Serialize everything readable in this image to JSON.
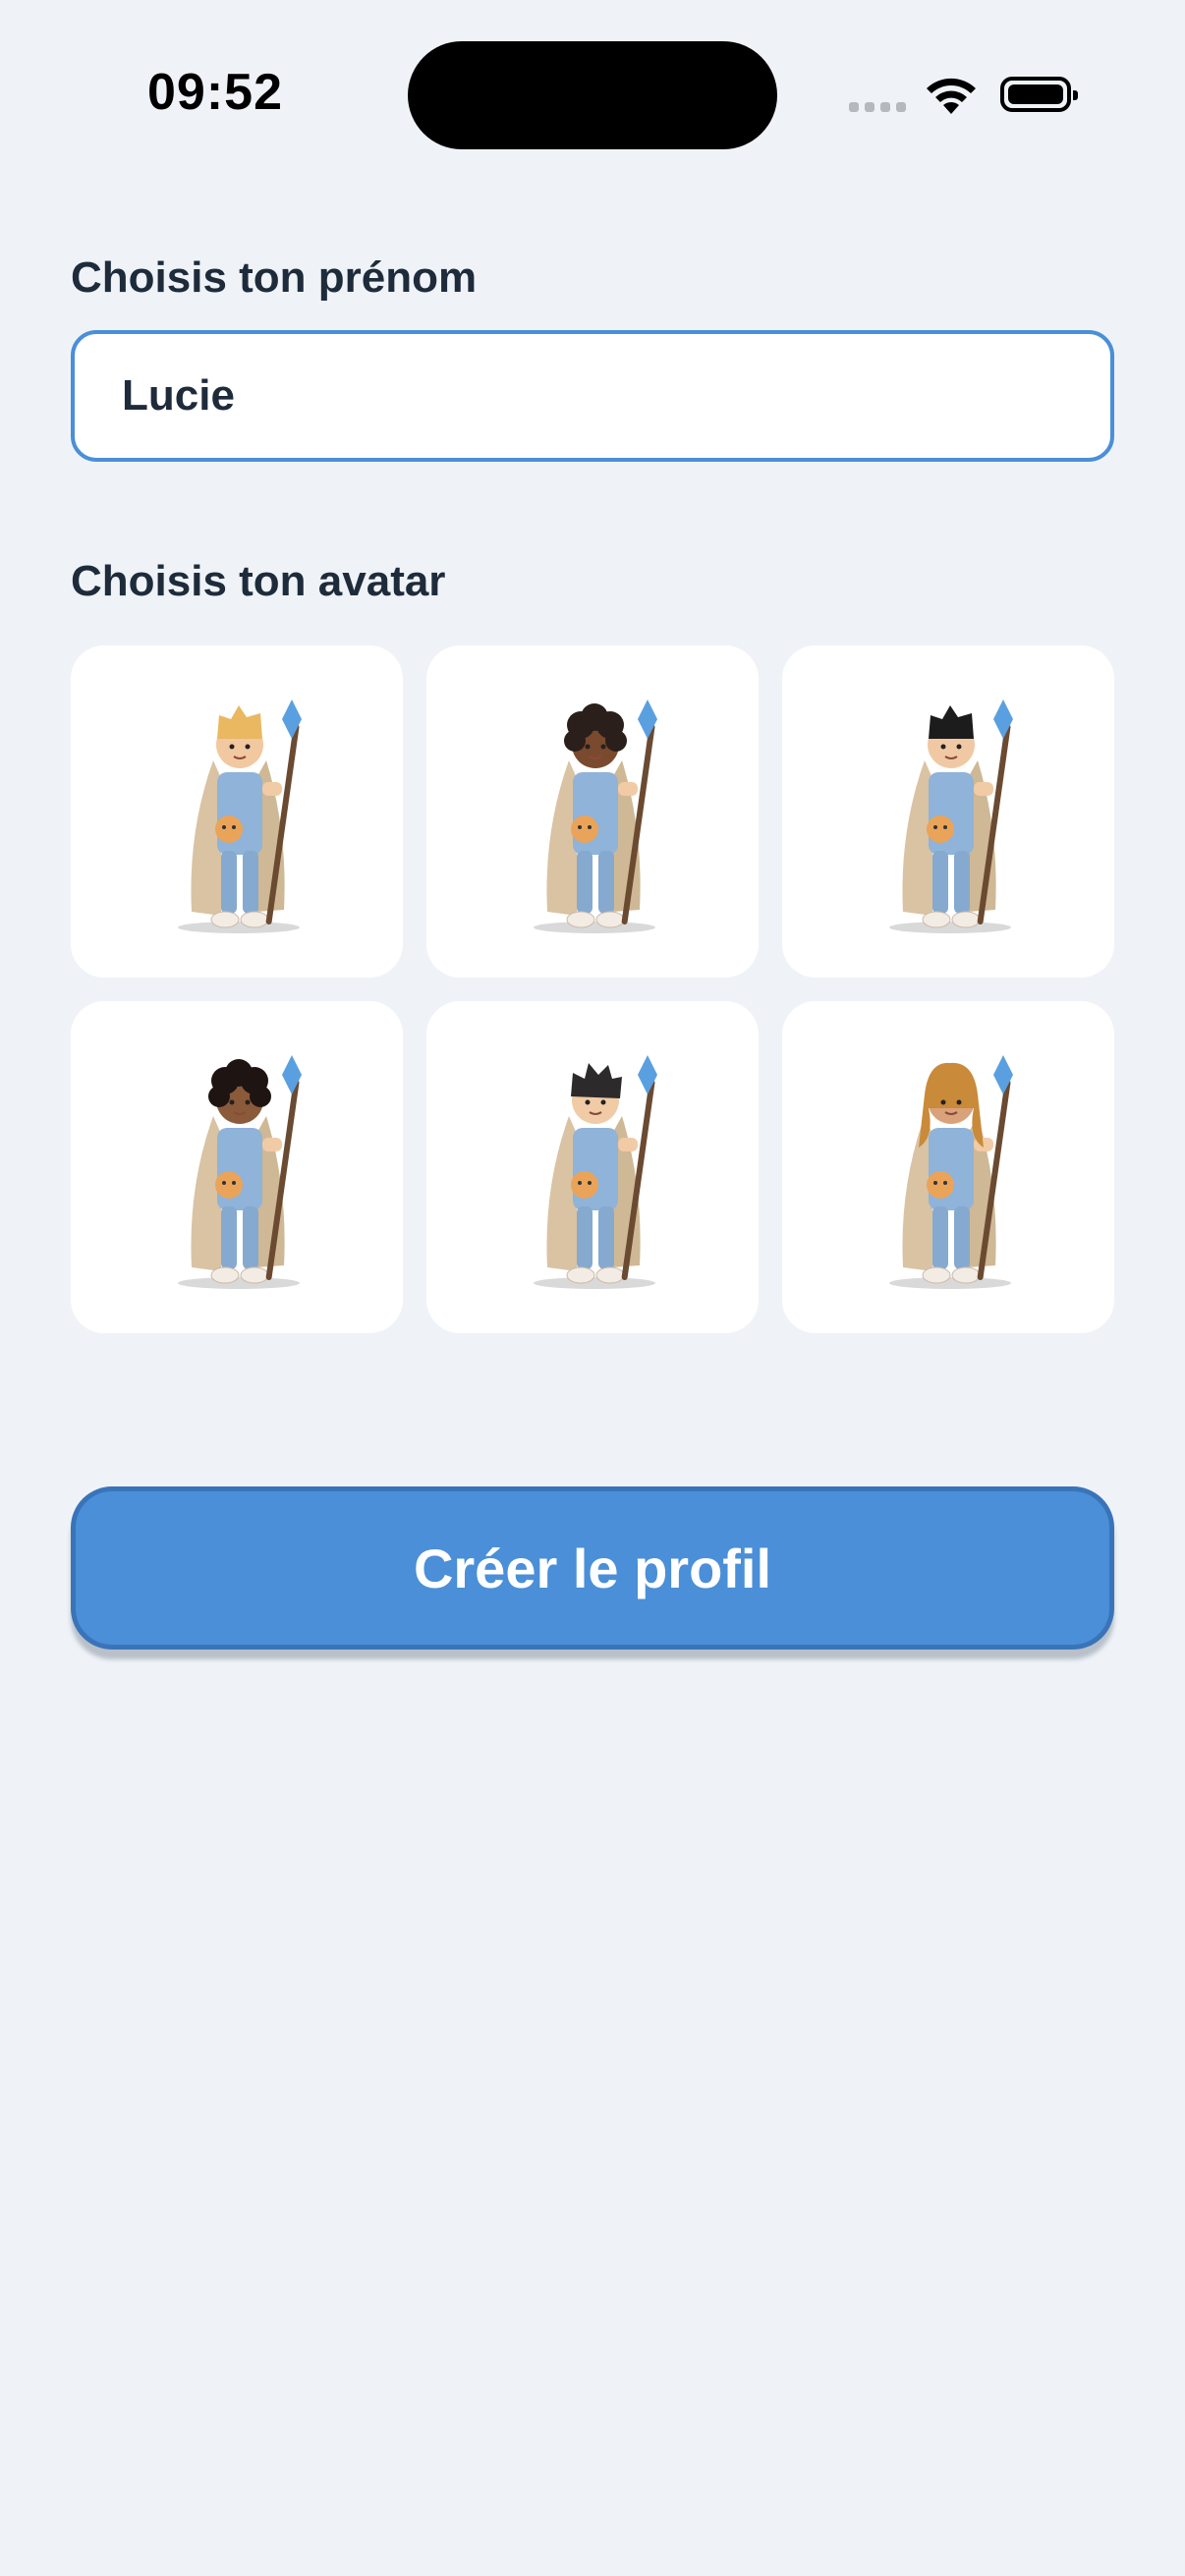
{
  "status": {
    "time": "09:52"
  },
  "form": {
    "name_label": "Choisis ton prénom",
    "name_value": "Lucie",
    "avatar_label": "Choisis ton avatar",
    "submit_label": "Créer le profil"
  },
  "avatars": [
    {
      "hair": "#e9b860",
      "skin": "#f2c8a0",
      "style": "short"
    },
    {
      "hair": "#2a1f1a",
      "skin": "#7a4a2e",
      "style": "curly"
    },
    {
      "hair": "#1c1c1c",
      "skin": "#f0c9a4",
      "style": "short"
    },
    {
      "hair": "#1e1512",
      "skin": "#8b5a3a",
      "style": "curly"
    },
    {
      "hair": "#2c2a2a",
      "skin": "#f1cba6",
      "style": "messy"
    },
    {
      "hair": "#c98a3a",
      "skin": "#d9a27a",
      "style": "long"
    }
  ],
  "colors": {
    "accent": "#4a8fd8",
    "background": "#eff3f8",
    "text": "#1e2b3b"
  }
}
